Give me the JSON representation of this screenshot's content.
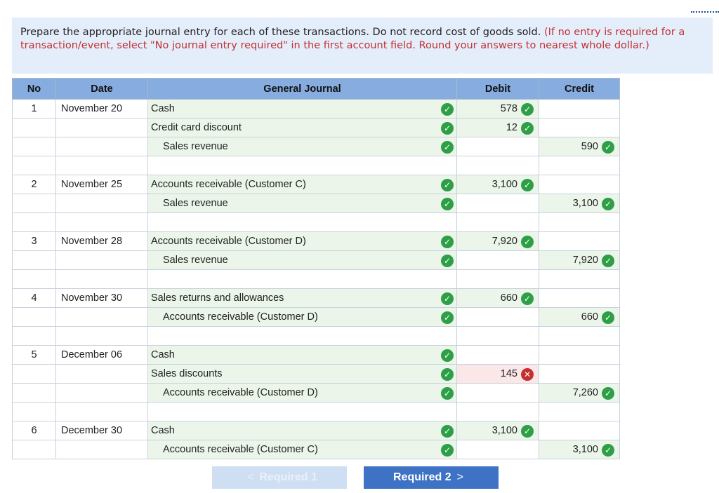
{
  "instructions": {
    "main": "Prepare the appropriate journal entry for each of these transactions. Do not record cost of goods sold.",
    "note": "(If no entry is required for a transaction/event, select \"No journal entry required\" in the first account field. Round your answers to nearest whole dollar.)"
  },
  "table": {
    "headers": [
      "No",
      "Date",
      "General Journal",
      "Debit",
      "Credit"
    ],
    "rows": [
      {
        "no": "1",
        "date": "November 20",
        "account": "Cash",
        "debit": "578",
        "credit": ""
      },
      {
        "no": "",
        "date": "",
        "account": "Credit card discount",
        "debit": "12",
        "credit": ""
      },
      {
        "no": "",
        "date": "",
        "account": "Sales revenue",
        "debit": "",
        "credit": "590"
      },
      {
        "no": "2",
        "date": "November 25",
        "account": "Accounts receivable (Customer C)",
        "debit": "3,100",
        "credit": ""
      },
      {
        "no": "",
        "date": "",
        "account": "Sales revenue",
        "debit": "",
        "credit": "3,100"
      },
      {
        "no": "3",
        "date": "November 28",
        "account": "Accounts receivable (Customer D)",
        "debit": "7,920",
        "credit": ""
      },
      {
        "no": "",
        "date": "",
        "account": "Sales revenue",
        "debit": "",
        "credit": "7,920"
      },
      {
        "no": "4",
        "date": "November 30",
        "account": "Sales returns and allowances",
        "debit": "660",
        "credit": ""
      },
      {
        "no": "",
        "date": "",
        "account": "Accounts receivable (Customer D)",
        "debit": "",
        "credit": "660"
      },
      {
        "no": "5",
        "date": "December 06",
        "account": "Cash",
        "debit": "",
        "credit": ""
      },
      {
        "no": "",
        "date": "",
        "account": "Sales discounts",
        "debit": "145",
        "credit": ""
      },
      {
        "no": "",
        "date": "",
        "account": "Accounts receivable (Customer D)",
        "debit": "",
        "credit": "7,260"
      },
      {
        "no": "6",
        "date": "December 30",
        "account": "Cash",
        "debit": "3,100",
        "credit": ""
      },
      {
        "no": "",
        "date": "",
        "account": "Accounts receivable (Customer C)",
        "debit": "",
        "credit": "3,100"
      }
    ]
  },
  "nav": {
    "prev_label": "Required 1",
    "next_label": "Required 2"
  },
  "icons": {
    "correct": "check-circle-icon",
    "incorrect": "x-circle-icon"
  },
  "colors": {
    "correct": "#2e9e47",
    "incorrect": "#c42f2f",
    "instruction_note": "#c43030",
    "header_bg": "#86ace0",
    "nav_active": "#3d72c4"
  }
}
